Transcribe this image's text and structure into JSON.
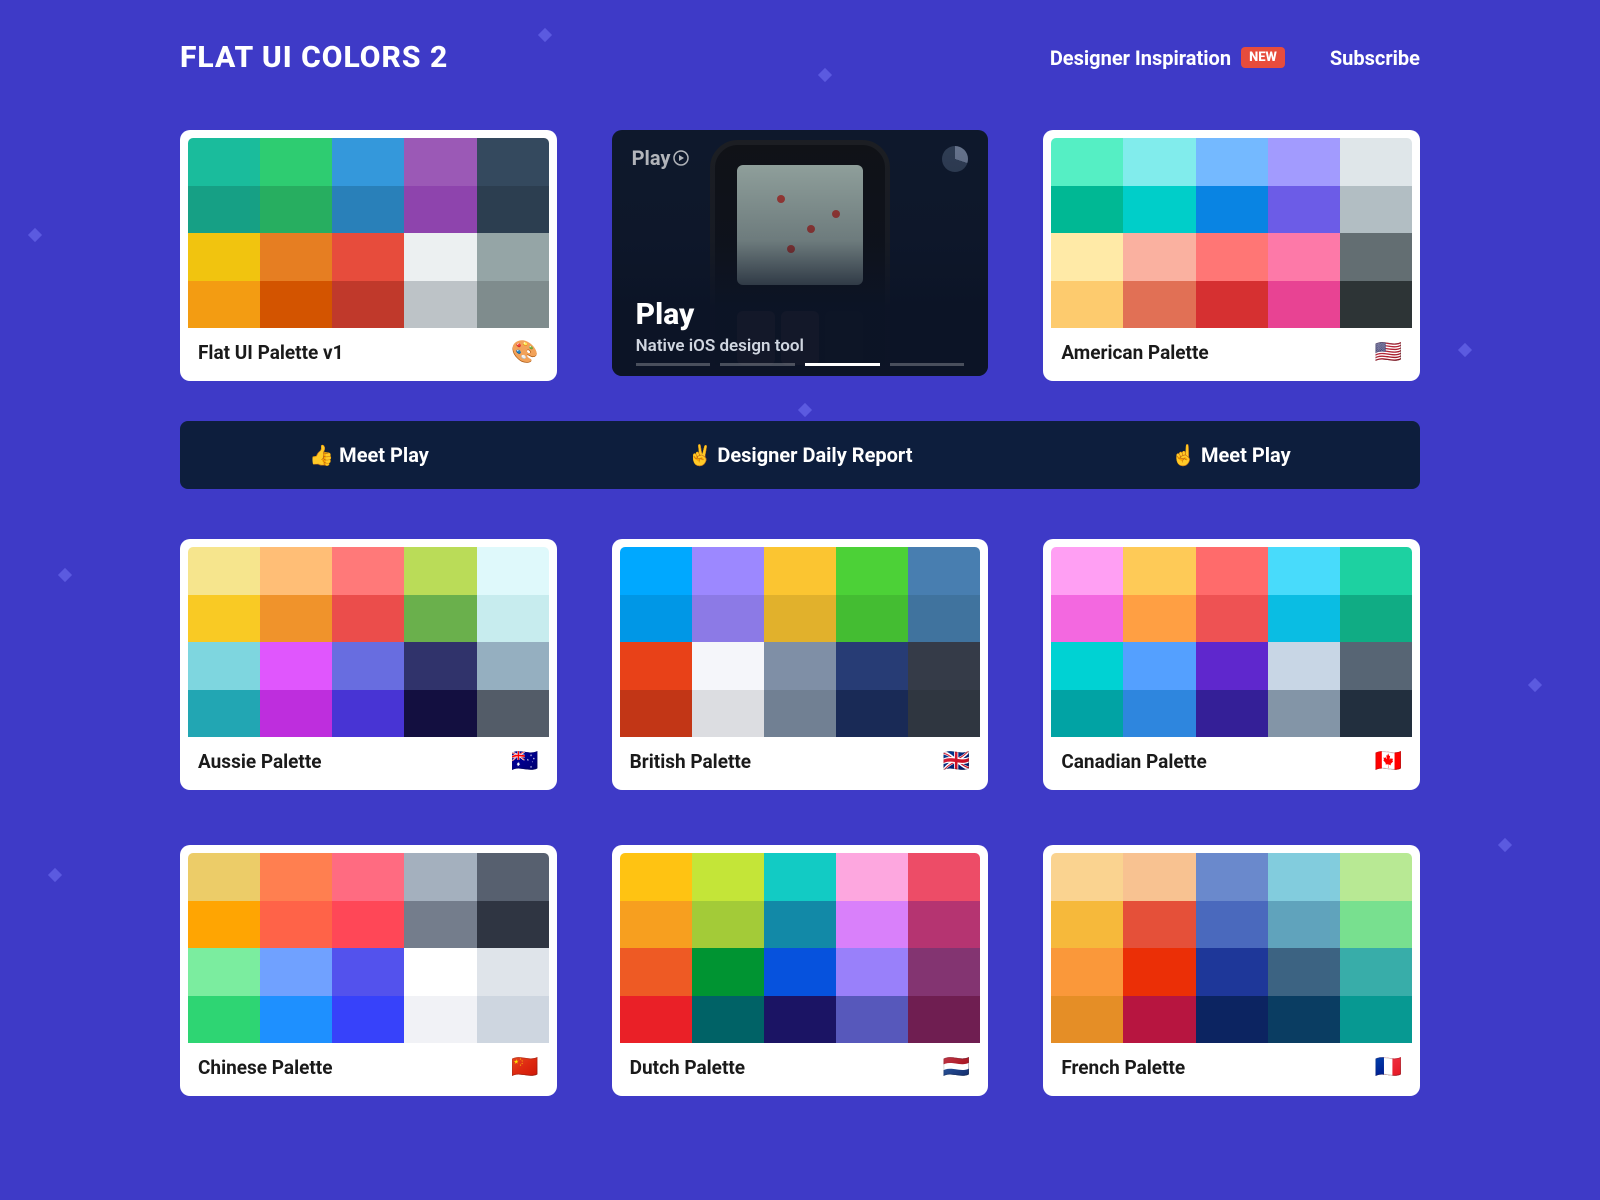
{
  "header": {
    "logo": "FLAT UI COLORS 2",
    "nav": {
      "inspiration": "Designer Inspiration",
      "badge": "NEW",
      "subscribe": "Subscribe"
    }
  },
  "ad": {
    "logo": "Play",
    "title": "Play",
    "subtitle": "Native iOS design tool"
  },
  "promo": {
    "item1": "👍 Meet Play",
    "item2": "✌️ Designer Daily Report",
    "item3": "☝️ Meet Play"
  },
  "palettes": {
    "flatui": {
      "title": "Flat UI Palette v1",
      "flag": "🎨",
      "colors": [
        "#1abc9c",
        "#2ecc71",
        "#3498db",
        "#9b59b6",
        "#34495e",
        "#16a085",
        "#27ae60",
        "#2980b9",
        "#8e44ad",
        "#2c3e50",
        "#f1c40f",
        "#e67e22",
        "#e74c3c",
        "#ecf0f1",
        "#95a5a6",
        "#f39c12",
        "#d35400",
        "#c0392b",
        "#bdc3c7",
        "#7f8c8d"
      ]
    },
    "american": {
      "title": "American Palette",
      "flag": "🇺🇸",
      "colors": [
        "#55efc4",
        "#81ecec",
        "#74b9ff",
        "#a29bfe",
        "#dfe6e9",
        "#00b894",
        "#00cec9",
        "#0984e3",
        "#6c5ce7",
        "#b2bec3",
        "#ffeaa7",
        "#fab1a0",
        "#ff7675",
        "#fd79a8",
        "#636e72",
        "#fdcb6e",
        "#e17055",
        "#d63031",
        "#e84393",
        "#2d3436"
      ]
    },
    "aussie": {
      "title": "Aussie Palette",
      "flag": "🇦🇺",
      "colors": [
        "#f6e58d",
        "#ffbe76",
        "#ff7979",
        "#badc58",
        "#dff9fb",
        "#f9ca24",
        "#f0932b",
        "#eb4d4b",
        "#6ab04c",
        "#c7ecee",
        "#7ed6df",
        "#e056fd",
        "#686de0",
        "#30336b",
        "#95afc0",
        "#22a6b3",
        "#be2edd",
        "#4834d4",
        "#130f40",
        "#535c68"
      ]
    },
    "british": {
      "title": "British Palette",
      "flag": "🇬🇧",
      "colors": [
        "#00a8ff",
        "#9c88ff",
        "#fbc531",
        "#4cd137",
        "#487eb0",
        "#0097e6",
        "#8c7ae6",
        "#e1b12c",
        "#44bd32",
        "#40739e",
        "#e84118",
        "#f5f6fa",
        "#7f8fa6",
        "#273c75",
        "#353b48",
        "#c23616",
        "#dcdde1",
        "#718093",
        "#192a56",
        "#2f3640"
      ]
    },
    "canadian": {
      "title": "Canadian Palette",
      "flag": "🇨🇦",
      "colors": [
        "#ff9ff3",
        "#feca57",
        "#ff6b6b",
        "#48dbfb",
        "#1dd1a1",
        "#f368e0",
        "#ff9f43",
        "#ee5253",
        "#0abde3",
        "#10ac84",
        "#00d2d3",
        "#54a0ff",
        "#5f27cd",
        "#c8d6e5",
        "#576574",
        "#01a3a4",
        "#2e86de",
        "#341f97",
        "#8395a7",
        "#222f3e"
      ]
    },
    "chinese": {
      "title": "Chinese Palette",
      "flag": "🇨🇳",
      "colors": [
        "#eccc68",
        "#ff7f50",
        "#ff6b81",
        "#a4b0be",
        "#57606f",
        "#ffa502",
        "#ff6348",
        "#ff4757",
        "#747d8c",
        "#2f3542",
        "#7bed9f",
        "#70a1ff",
        "#5352ed",
        "#ffffff",
        "#dfe4ea",
        "#2ed573",
        "#1e90ff",
        "#3742fa",
        "#f1f2f6",
        "#ced6e0"
      ]
    },
    "dutch": {
      "title": "Dutch Palette",
      "flag": "🇳🇱",
      "colors": [
        "#ffc312",
        "#c4e538",
        "#12cbc4",
        "#fda7df",
        "#ed4c67",
        "#f79f1f",
        "#a3cb38",
        "#1289a7",
        "#d980fa",
        "#b53471",
        "#ee5a24",
        "#009432",
        "#0652dd",
        "#9980fa",
        "#833471",
        "#ea2027",
        "#006266",
        "#1b1464",
        "#5758bb",
        "#6f1e51"
      ]
    },
    "french": {
      "title": "French Palette",
      "flag": "🇫🇷",
      "colors": [
        "#fad390",
        "#f8c291",
        "#6a89cc",
        "#82ccdd",
        "#b8e994",
        "#f6b93b",
        "#e55039",
        "#4a69bd",
        "#60a3bc",
        "#78e08f",
        "#fa983a",
        "#eb2f06",
        "#1e3799",
        "#3c6382",
        "#38ada9",
        "#e58e26",
        "#b71540",
        "#0c2461",
        "#0a3d62",
        "#079992"
      ]
    }
  }
}
